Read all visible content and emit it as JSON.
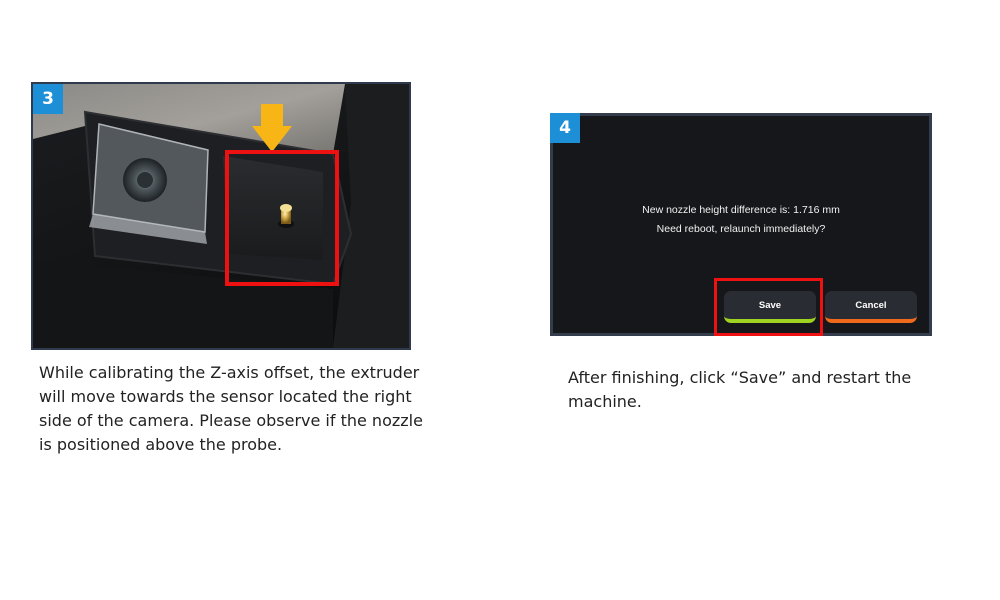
{
  "step3": {
    "badge": "3",
    "caption_lines": [
      "While calibrating the Z-axis offset, the extruder",
      "will move towards the sensor located the right",
      "side of the camera. Please observe if the nozzle",
      "is positioned above the probe."
    ]
  },
  "step4": {
    "badge": "4",
    "dialog": {
      "line1": "New nozzle height difference is: 1.716 mm",
      "line2": "Need reboot, relaunch immediately?",
      "save_label": "Save",
      "cancel_label": "Cancel"
    },
    "caption_lines": [
      "After finishing, click “Save” and restart the",
      "machine."
    ]
  },
  "colors": {
    "badge": "#1d8fd6",
    "highlight": "#ee1111",
    "arrow": "#f7b615",
    "save_accent": "#9ed321",
    "cancel_accent": "#f06a1c"
  },
  "icons": [
    "down-arrow-icon"
  ]
}
